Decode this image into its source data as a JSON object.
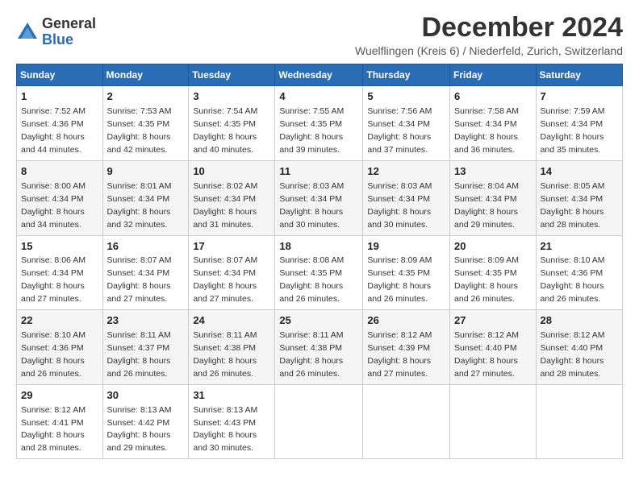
{
  "logo": {
    "general": "General",
    "blue": "Blue"
  },
  "title": "December 2024",
  "location": "Wuelflingen (Kreis 6) / Niederfeld, Zurich, Switzerland",
  "days_of_week": [
    "Sunday",
    "Monday",
    "Tuesday",
    "Wednesday",
    "Thursday",
    "Friday",
    "Saturday"
  ],
  "weeks": [
    [
      {
        "day": "1",
        "sunrise": "Sunrise: 7:52 AM",
        "sunset": "Sunset: 4:36 PM",
        "daylight": "Daylight: 8 hours and 44 minutes."
      },
      {
        "day": "2",
        "sunrise": "Sunrise: 7:53 AM",
        "sunset": "Sunset: 4:35 PM",
        "daylight": "Daylight: 8 hours and 42 minutes."
      },
      {
        "day": "3",
        "sunrise": "Sunrise: 7:54 AM",
        "sunset": "Sunset: 4:35 PM",
        "daylight": "Daylight: 8 hours and 40 minutes."
      },
      {
        "day": "4",
        "sunrise": "Sunrise: 7:55 AM",
        "sunset": "Sunset: 4:35 PM",
        "daylight": "Daylight: 8 hours and 39 minutes."
      },
      {
        "day": "5",
        "sunrise": "Sunrise: 7:56 AM",
        "sunset": "Sunset: 4:34 PM",
        "daylight": "Daylight: 8 hours and 37 minutes."
      },
      {
        "day": "6",
        "sunrise": "Sunrise: 7:58 AM",
        "sunset": "Sunset: 4:34 PM",
        "daylight": "Daylight: 8 hours and 36 minutes."
      },
      {
        "day": "7",
        "sunrise": "Sunrise: 7:59 AM",
        "sunset": "Sunset: 4:34 PM",
        "daylight": "Daylight: 8 hours and 35 minutes."
      }
    ],
    [
      {
        "day": "8",
        "sunrise": "Sunrise: 8:00 AM",
        "sunset": "Sunset: 4:34 PM",
        "daylight": "Daylight: 8 hours and 34 minutes."
      },
      {
        "day": "9",
        "sunrise": "Sunrise: 8:01 AM",
        "sunset": "Sunset: 4:34 PM",
        "daylight": "Daylight: 8 hours and 32 minutes."
      },
      {
        "day": "10",
        "sunrise": "Sunrise: 8:02 AM",
        "sunset": "Sunset: 4:34 PM",
        "daylight": "Daylight: 8 hours and 31 minutes."
      },
      {
        "day": "11",
        "sunrise": "Sunrise: 8:03 AM",
        "sunset": "Sunset: 4:34 PM",
        "daylight": "Daylight: 8 hours and 30 minutes."
      },
      {
        "day": "12",
        "sunrise": "Sunrise: 8:03 AM",
        "sunset": "Sunset: 4:34 PM",
        "daylight": "Daylight: 8 hours and 30 minutes."
      },
      {
        "day": "13",
        "sunrise": "Sunrise: 8:04 AM",
        "sunset": "Sunset: 4:34 PM",
        "daylight": "Daylight: 8 hours and 29 minutes."
      },
      {
        "day": "14",
        "sunrise": "Sunrise: 8:05 AM",
        "sunset": "Sunset: 4:34 PM",
        "daylight": "Daylight: 8 hours and 28 minutes."
      }
    ],
    [
      {
        "day": "15",
        "sunrise": "Sunrise: 8:06 AM",
        "sunset": "Sunset: 4:34 PM",
        "daylight": "Daylight: 8 hours and 27 minutes."
      },
      {
        "day": "16",
        "sunrise": "Sunrise: 8:07 AM",
        "sunset": "Sunset: 4:34 PM",
        "daylight": "Daylight: 8 hours and 27 minutes."
      },
      {
        "day": "17",
        "sunrise": "Sunrise: 8:07 AM",
        "sunset": "Sunset: 4:34 PM",
        "daylight": "Daylight: 8 hours and 27 minutes."
      },
      {
        "day": "18",
        "sunrise": "Sunrise: 8:08 AM",
        "sunset": "Sunset: 4:35 PM",
        "daylight": "Daylight: 8 hours and 26 minutes."
      },
      {
        "day": "19",
        "sunrise": "Sunrise: 8:09 AM",
        "sunset": "Sunset: 4:35 PM",
        "daylight": "Daylight: 8 hours and 26 minutes."
      },
      {
        "day": "20",
        "sunrise": "Sunrise: 8:09 AM",
        "sunset": "Sunset: 4:35 PM",
        "daylight": "Daylight: 8 hours and 26 minutes."
      },
      {
        "day": "21",
        "sunrise": "Sunrise: 8:10 AM",
        "sunset": "Sunset: 4:36 PM",
        "daylight": "Daylight: 8 hours and 26 minutes."
      }
    ],
    [
      {
        "day": "22",
        "sunrise": "Sunrise: 8:10 AM",
        "sunset": "Sunset: 4:36 PM",
        "daylight": "Daylight: 8 hours and 26 minutes."
      },
      {
        "day": "23",
        "sunrise": "Sunrise: 8:11 AM",
        "sunset": "Sunset: 4:37 PM",
        "daylight": "Daylight: 8 hours and 26 minutes."
      },
      {
        "day": "24",
        "sunrise": "Sunrise: 8:11 AM",
        "sunset": "Sunset: 4:38 PM",
        "daylight": "Daylight: 8 hours and 26 minutes."
      },
      {
        "day": "25",
        "sunrise": "Sunrise: 8:11 AM",
        "sunset": "Sunset: 4:38 PM",
        "daylight": "Daylight: 8 hours and 26 minutes."
      },
      {
        "day": "26",
        "sunrise": "Sunrise: 8:12 AM",
        "sunset": "Sunset: 4:39 PM",
        "daylight": "Daylight: 8 hours and 27 minutes."
      },
      {
        "day": "27",
        "sunrise": "Sunrise: 8:12 AM",
        "sunset": "Sunset: 4:40 PM",
        "daylight": "Daylight: 8 hours and 27 minutes."
      },
      {
        "day": "28",
        "sunrise": "Sunrise: 8:12 AM",
        "sunset": "Sunset: 4:40 PM",
        "daylight": "Daylight: 8 hours and 28 minutes."
      }
    ],
    [
      {
        "day": "29",
        "sunrise": "Sunrise: 8:12 AM",
        "sunset": "Sunset: 4:41 PM",
        "daylight": "Daylight: 8 hours and 28 minutes."
      },
      {
        "day": "30",
        "sunrise": "Sunrise: 8:13 AM",
        "sunset": "Sunset: 4:42 PM",
        "daylight": "Daylight: 8 hours and 29 minutes."
      },
      {
        "day": "31",
        "sunrise": "Sunrise: 8:13 AM",
        "sunset": "Sunset: 4:43 PM",
        "daylight": "Daylight: 8 hours and 30 minutes."
      },
      null,
      null,
      null,
      null
    ]
  ]
}
